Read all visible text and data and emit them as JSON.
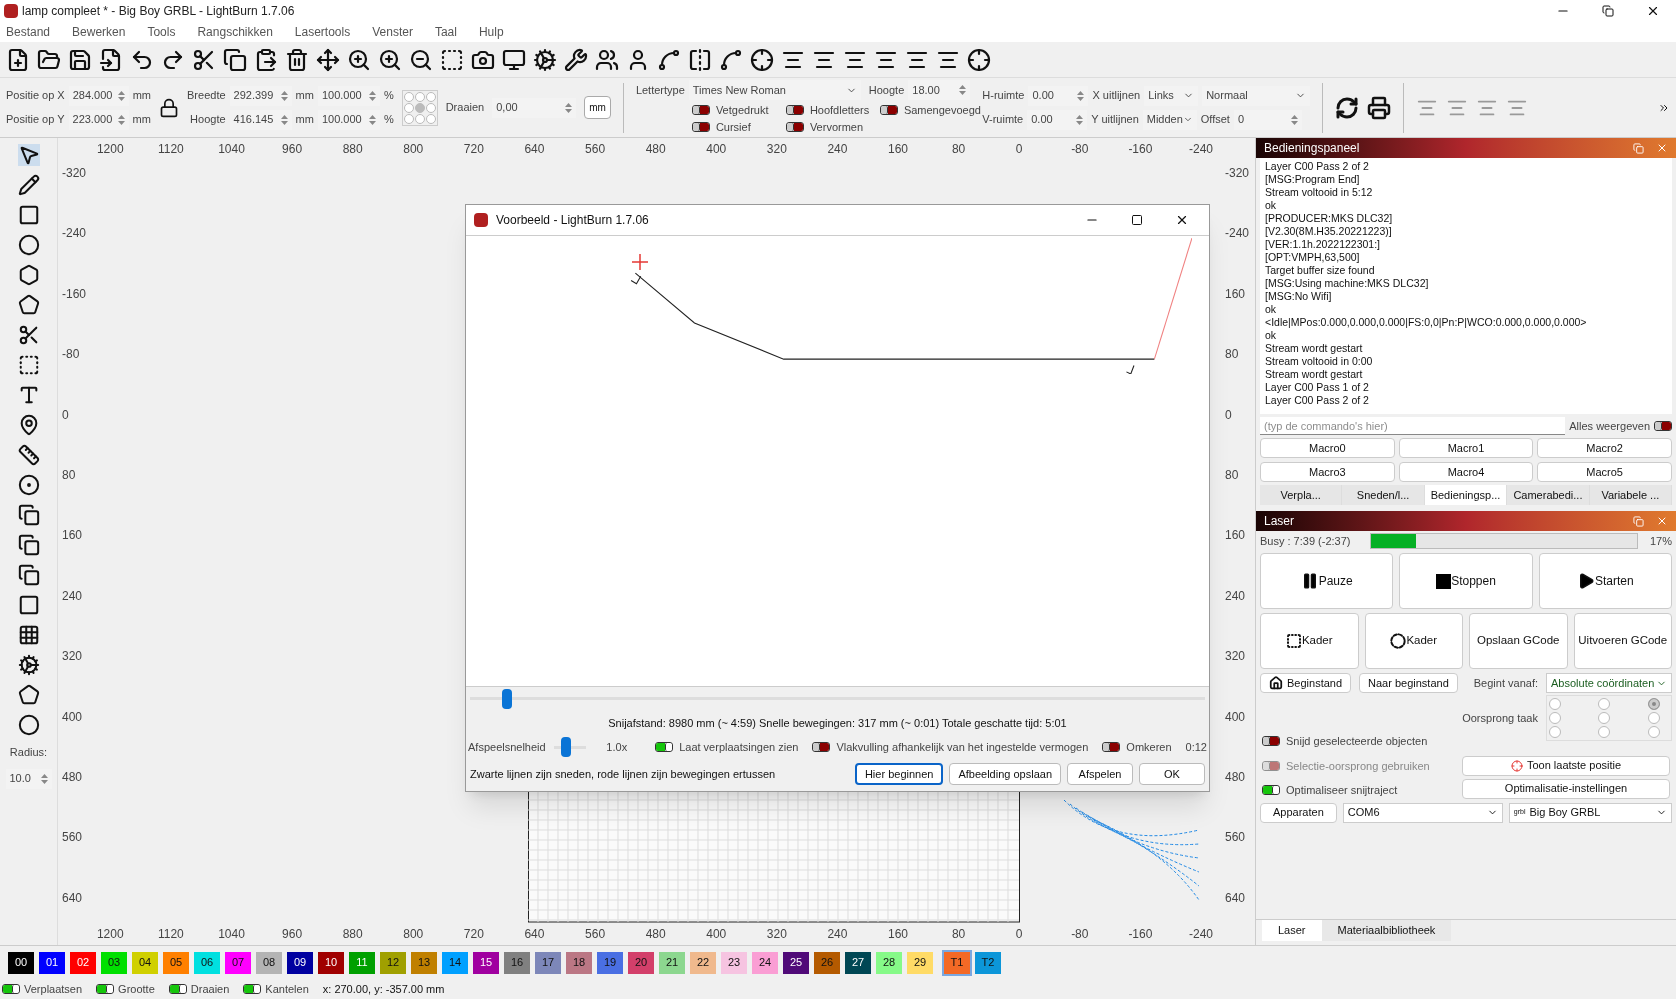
{
  "window": {
    "title": "lamp compleet * - Big Boy GRBL - LightBurn 1.7.06"
  },
  "menu": [
    "Bestand",
    "Bewerken",
    "Tools",
    "Rangschikken",
    "Lasertools",
    "Venster",
    "Taal",
    "Hulp"
  ],
  "props": {
    "pos_x": {
      "label": "Positie op X",
      "value": "284.000",
      "unit": "mm"
    },
    "pos_y": {
      "label": "Positie op Y",
      "value": "223.000",
      "unit": "mm"
    },
    "width": {
      "label": "Breedte",
      "value": "292.399",
      "unit": "mm",
      "pct": "100.000",
      "pct_unit": "%"
    },
    "height": {
      "label": "Hoogte",
      "value": "416.145",
      "unit": "mm",
      "pct": "100.000",
      "pct_unit": "%"
    },
    "rotate": {
      "label": "Draaien",
      "value": "0,00"
    },
    "unit_button": "mm",
    "font": {
      "label": "Lettertype",
      "value": "Times New Roman"
    },
    "font_height": {
      "label": "Hoogte",
      "value": "18.00"
    },
    "h_space": {
      "label": "H-ruimte",
      "value": "0.00"
    },
    "v_space": {
      "label": "V-ruimte",
      "value": "0.00"
    },
    "x_align": {
      "label": "X uitlijnen",
      "value": "Links"
    },
    "y_align": {
      "label": "Y uitlijnen",
      "value": "Midden"
    },
    "style": {
      "value": "Normaal"
    },
    "offset": {
      "label": "Offset",
      "value": "0"
    },
    "toggles": [
      {
        "label": "Vetgedrukt",
        "on": false
      },
      {
        "label": "Hoofdletters",
        "on": false
      },
      {
        "label": "Samengevoegd",
        "on": false
      },
      {
        "label": "Cursief",
        "on": false
      },
      {
        "label": "Vervormen",
        "on": false
      }
    ]
  },
  "tools": {
    "radius_label": "Radius:",
    "radius_value": "10.0"
  },
  "canvas": {
    "top_ruler": [
      "1200",
      "1120",
      "1040",
      "960",
      "880",
      "800",
      "720",
      "640",
      "560",
      "480",
      "400",
      "320",
      "240",
      "160",
      "80",
      "0",
      "-80",
      "-160",
      "-240"
    ],
    "left_ruler": [
      "-320",
      "-240",
      "-160",
      "-80",
      "0",
      "80",
      "160",
      "240",
      "320",
      "400",
      "480",
      "560",
      "640"
    ],
    "right_ruler": [
      "-320",
      "-240",
      "160",
      "80",
      "0",
      "80",
      "160",
      "240",
      "320",
      "400",
      "480",
      "560",
      "640"
    ],
    "bottom_ruler": [
      "1200",
      "1120",
      "1040",
      "960",
      "880",
      "800",
      "720",
      "640",
      "560",
      "480",
      "400",
      "320",
      "240",
      "160",
      "80",
      "0",
      "-80",
      "-160",
      "-240"
    ]
  },
  "preview": {
    "title": "Voorbeeld - LightBurn 1.7.06",
    "position": {
      "level": 0.05
    },
    "stats": "Snijafstand: 8980 mm (~ 4:59) Snelle bewegingen: 317 mm (~ 0:01) Totale geschatte tijd: 5:01",
    "speed": {
      "label": "Afspeelsnelheid",
      "level": 0.37,
      "reading": "1.0x"
    },
    "toggles": [
      {
        "label": "Laat verplaatsingen zien",
        "on": true
      },
      {
        "label": "Vlakvulling afhankelijk van het ingestelde vermogen",
        "on": false
      },
      {
        "label": "Omkeren",
        "on": false
      }
    ],
    "time": "0:12",
    "note": "Zwarte lijnen zijn sneden, rode lijnen zijn bewegingen ertussen",
    "buttons": [
      {
        "label": "Hier beginnen",
        "focused": true
      },
      {
        "label": "Afbeelding opslaan",
        "focused": false
      },
      {
        "label": "Afspelen",
        "focused": false
      },
      {
        "label": "OK",
        "focused": false
      }
    ]
  },
  "console": {
    "title": "Bedieningspaneel",
    "lines": [
      "Layer C00 Pass 2 of 2",
      "[MSG:Program End]",
      "Stream voltooid in 5:12",
      "ok",
      "[PRODUCER:MKS DLC32]",
      "[V2.30(8M.H35.20221223)]",
      "[VER:1.1h.2022122301:]",
      "[OPT:VMPH,63,500]",
      "Target buffer size found",
      "[MSG:Using machine:MKS DLC32]",
      "[MSG:No Wifi]",
      "ok",
      "<Idle|MPos:0.000,0.000,0.000|FS:0,0|Pn:P|WCO:0.000,0.000,0.000>",
      "ok",
      "Stream wordt gestart",
      "Stream voltooid in 0:00",
      "Stream wordt gestart",
      "Layer C00 Pass 1 of 2",
      "Layer C00 Pass 2 of 2"
    ],
    "command_placeholder": "(typ de commando's hier)",
    "show_all": {
      "label": "Alles weergeven",
      "on": false
    },
    "macros": [
      "Macro0",
      "Macro1",
      "Macro2",
      "Macro3",
      "Macro4",
      "Macro5"
    ],
    "tabs": [
      {
        "label": "Verpla...",
        "selected": false
      },
      {
        "label": "Sneden/l...",
        "selected": false
      },
      {
        "label": "Bedieningsp...",
        "selected": true
      },
      {
        "label": "Camerabedi...",
        "selected": false
      },
      {
        "label": "Variabele ...",
        "selected": false
      }
    ]
  },
  "laser": {
    "title": "Laser",
    "status": "Busy : 7:39 (-2:37)",
    "progress": {
      "level": 0.17,
      "reading": "17%"
    },
    "run_buttons": [
      {
        "kind": "pause",
        "label": "Pauze"
      },
      {
        "kind": "stop",
        "label": "Stoppen"
      },
      {
        "kind": "start",
        "label": "Starten"
      }
    ],
    "frame_buttons": [
      {
        "kind": "frame",
        "label": "Kader"
      },
      {
        "kind": "circle-frame",
        "label": "Kader"
      },
      {
        "kind": "plain",
        "label": "Opslaan GCode"
      },
      {
        "kind": "plain",
        "label": "Uitvoeren GCode"
      }
    ],
    "home": "Beginstand",
    "go_home": "Naar beginstand",
    "start_from": {
      "label": "Begint vanaf:",
      "value": "Absolute coördinaten"
    },
    "origin": {
      "label": "Oorsprong taak",
      "options": [
        {
          "selected": false
        },
        {
          "selected": false
        },
        {
          "selected": true
        },
        {
          "selected": false
        },
        {
          "selected": false
        },
        {
          "selected": false
        },
        {
          "selected": false
        },
        {
          "selected": false
        },
        {
          "selected": false
        }
      ]
    },
    "options": [
      {
        "label": "Snijd geselecteerde objecten",
        "on": false,
        "disabled": false
      },
      {
        "label": "Selectie-oorsprong gebruiken",
        "on": false,
        "disabled": true
      },
      {
        "label": "Optimaliseer snijtraject",
        "on": true,
        "disabled": false
      }
    ],
    "show_last": "Toon laatste positie",
    "opt_settings": "Optimalisatie-instellingen",
    "devices": "Apparaten",
    "port": "COM6",
    "device_logo": "grbl",
    "device": "Big Boy GRBL",
    "tabs": [
      {
        "label": "Laser",
        "selected": true
      },
      {
        "label": "Materiaalbibliotheek",
        "selected": false
      }
    ]
  },
  "palette": [
    {
      "label": "00",
      "color": "#000000"
    },
    {
      "label": "01",
      "color": "#0000ff"
    },
    {
      "label": "02",
      "color": "#ff0000"
    },
    {
      "label": "03",
      "color": "#00e000"
    },
    {
      "label": "04",
      "color": "#d0d000"
    },
    {
      "label": "05",
      "color": "#ff8000"
    },
    {
      "label": "06",
      "color": "#00e0e0"
    },
    {
      "label": "07",
      "color": "#ff00ff"
    },
    {
      "label": "08",
      "color": "#b4b4b4"
    },
    {
      "label": "09",
      "color": "#0000a0"
    },
    {
      "label": "10",
      "color": "#a00000"
    },
    {
      "label": "11",
      "color": "#00a000"
    },
    {
      "label": "12",
      "color": "#a0a000"
    },
    {
      "label": "13",
      "color": "#c08000"
    },
    {
      "label": "14",
      "color": "#00a0ff"
    },
    {
      "label": "15",
      "color": "#a000a0"
    },
    {
      "label": "16",
      "color": "#808080"
    },
    {
      "label": "17",
      "color": "#7d87b9"
    },
    {
      "label": "18",
      "color": "#bb7784"
    },
    {
      "label": "19",
      "color": "#4a6fe3"
    },
    {
      "label": "20",
      "color": "#d33f6a"
    },
    {
      "label": "21",
      "color": "#8cd78f"
    },
    {
      "label": "22",
      "color": "#f0b98d"
    },
    {
      "label": "23",
      "color": "#f6c4e1"
    },
    {
      "label": "24",
      "color": "#fa9ed4"
    },
    {
      "label": "25",
      "color": "#500a78"
    },
    {
      "label": "26",
      "color": "#b45a00"
    },
    {
      "label": "27",
      "color": "#004754"
    },
    {
      "label": "28",
      "color": "#86fa88"
    },
    {
      "label": "29",
      "color": "#ffdb66"
    },
    {
      "label": "T1",
      "color": "#f36926"
    },
    {
      "label": "T2",
      "color": "#0c96d9"
    }
  ],
  "status_bar": {
    "toggles": [
      {
        "label": "Verplaatsen",
        "on": true
      },
      {
        "label": "Grootte",
        "on": true
      },
      {
        "label": "Draaien",
        "on": true
      },
      {
        "label": "Kantelen",
        "on": true
      }
    ],
    "coords": "x: 270.00, y: -357.00 mm"
  }
}
